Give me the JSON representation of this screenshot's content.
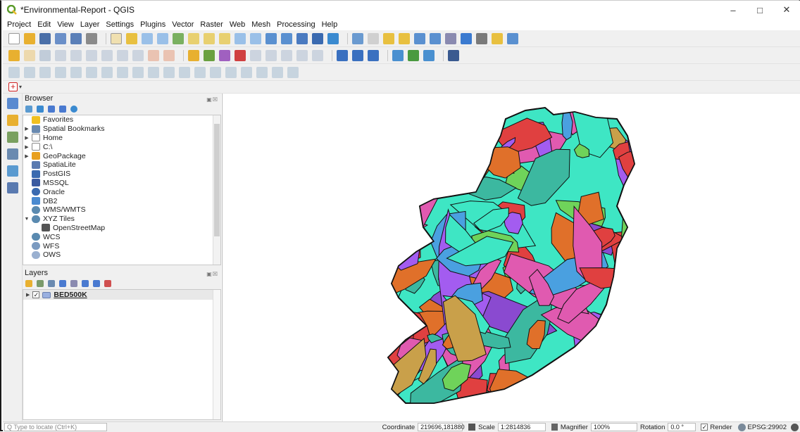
{
  "window": {
    "title": "*Environmental-Report - QGIS",
    "controls": [
      "–",
      "□",
      "✕"
    ]
  },
  "menu": [
    "Project",
    "Edit",
    "View",
    "Layer",
    "Settings",
    "Plugins",
    "Vector",
    "Raster",
    "Web",
    "Mesh",
    "Processing",
    "Help"
  ],
  "browser": {
    "title": "Browser",
    "items": [
      {
        "label": "Favorites",
        "icon": "star-icon",
        "expand": ""
      },
      {
        "label": "Spatial Bookmarks",
        "icon": "bookmark-icon",
        "expand": "▶"
      },
      {
        "label": "Home",
        "icon": "folder-icon",
        "expand": "▶"
      },
      {
        "label": "C:\\",
        "icon": "folder-icon",
        "expand": "▶"
      },
      {
        "label": "GeoPackage",
        "icon": "geopackage-icon",
        "expand": "▶"
      },
      {
        "label": "SpatiaLite",
        "icon": "spatialite-icon",
        "expand": ""
      },
      {
        "label": "PostGIS",
        "icon": "postgis-icon",
        "expand": ""
      },
      {
        "label": "MSSQL",
        "icon": "mssql-icon",
        "expand": ""
      },
      {
        "label": "Oracle",
        "icon": "oracle-icon",
        "expand": ""
      },
      {
        "label": "DB2",
        "icon": "db2-icon",
        "expand": ""
      },
      {
        "label": "WMS/WMTS",
        "icon": "globe-icon",
        "expand": ""
      },
      {
        "label": "XYZ Tiles",
        "icon": "globe-icon",
        "expand": "▼"
      },
      {
        "label": "OpenStreetMap",
        "icon": "tiles-icon",
        "expand": "",
        "indent": true
      },
      {
        "label": "WCS",
        "icon": "globe-icon",
        "expand": ""
      },
      {
        "label": "WFS",
        "icon": "wfs-icon",
        "expand": ""
      },
      {
        "label": "OWS",
        "icon": "ows-icon",
        "expand": ""
      }
    ]
  },
  "layers": {
    "title": "Layers",
    "items": [
      {
        "label": "BED500K",
        "checked": "✓"
      }
    ]
  },
  "status": {
    "locate_placeholder": "Q  Type to locate (Ctrl+K)",
    "coordinate_label": "Coordinate",
    "coordinate_value": "219696,181880",
    "scale_label": "Scale",
    "scale_value": "1:2814836",
    "magnifier_label": "Magnifier",
    "magnifier_value": "100%",
    "rotation_label": "Rotation",
    "rotation_value": "0.0 °",
    "render_label": "Render",
    "render_checked": "✓",
    "crs": "EPSG:29902"
  },
  "map_colors": [
    "#3ee6c4",
    "#a35cf0",
    "#e0702a",
    "#c9a04a",
    "#e04040",
    "#4aa0e0",
    "#6fd35a",
    "#e05ab0",
    "#8a4ad0",
    "#3cb8a0"
  ]
}
